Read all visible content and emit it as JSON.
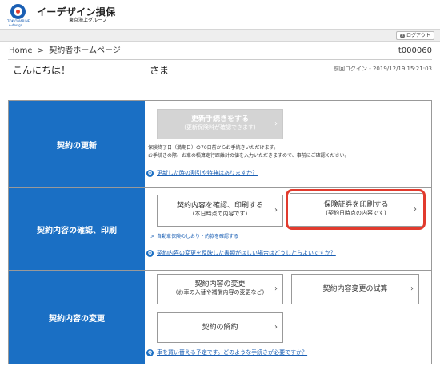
{
  "header": {
    "logo_en_line1": "TOKIOMARINE",
    "logo_en_line2": "e-design",
    "brand": "イーデザイン損保",
    "brand_sub": "東京海上グループ"
  },
  "topbar": {
    "logout_label": "ログアウト"
  },
  "breadcrumb": {
    "home": "Home",
    "sep": ">",
    "current": "契約者ホームページ"
  },
  "user_id": "t000060",
  "greeting": "こんにちは！",
  "honorific": "さま",
  "last_login": "前回ログイン - 2019/12/19 15:21:03",
  "sections": {
    "renewal": {
      "label": "契約の更新",
      "button_line1": "更新手続きをする",
      "button_line2": "(更新保険料が確認できます)",
      "note_line1": "保険終了日（満期日）の70日前からお手続きいただけます。",
      "note_line2": "お手続きの際、お車の積算走行距離計の値を入力いただきますので、事前にご確認ください。",
      "faq": "更新した時の割引や特典はありますか？"
    },
    "confirm": {
      "label": "契約内容の確認、印刷",
      "btn1_line1": "契約内容を確認、印刷する",
      "btn1_line2": "(本日時点の内容です)",
      "btn2_line1": "保険証券を印刷する",
      "btn2_line2": "(契約日時点の内容です)",
      "sublink_chev": ">",
      "sublink": "自動車保険のしおり・約款を確認する",
      "faq": "契約内容の変更を反映した書類がほしい場合はどうしたらよいですか？"
    },
    "change": {
      "label": "契約内容の変更",
      "btn1_line1": "契約内容の変更",
      "btn1_line2": "(お車の入替や補償内容の変更など)",
      "btn2_line1": "契約内容変更の試算",
      "btn3_line1": "契約の解約",
      "faq": "車を買い替える予定です。どのような手続きが必要ですか？"
    }
  },
  "icons": {
    "chevron": "›",
    "question": "Q"
  },
  "colors": {
    "accent_blue": "#1a6fc4",
    "highlight_red": "#e23b2e",
    "disabled_gray": "#d4d4d4"
  }
}
